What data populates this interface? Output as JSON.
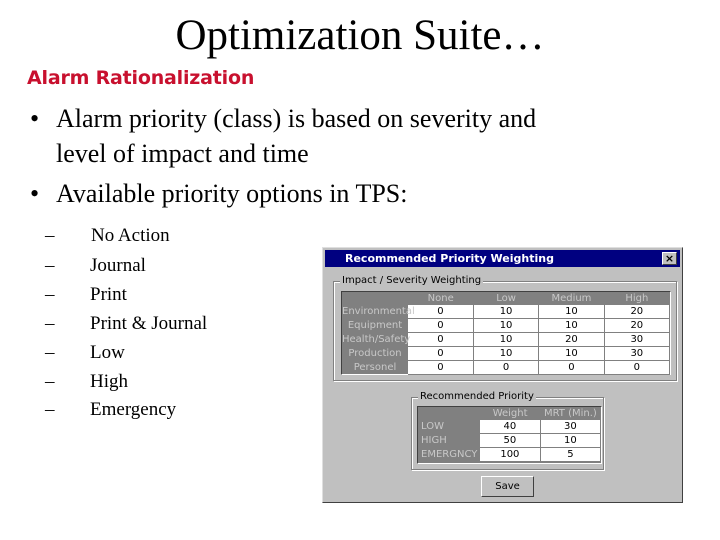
{
  "slide": {
    "title": "Optimization Suite…",
    "subtitle": "Alarm Rationalization",
    "bullets": [
      {
        "symbol": "•",
        "lines": [
          "Alarm priority (class) is based on severity and",
          "level of impact and time"
        ]
      },
      {
        "symbol": "•",
        "lines": [
          "Available priority options in TPS:"
        ]
      }
    ],
    "priority_options": [
      {
        "symbol": "–",
        "label": "No Action"
      },
      {
        "symbol": "–",
        "label": "Journal"
      },
      {
        "symbol": "–",
        "label": "Print"
      },
      {
        "symbol": "–",
        "label": "Print & Journal"
      },
      {
        "symbol": "–",
        "label": "Low"
      },
      {
        "symbol": "–",
        "label": "High"
      },
      {
        "symbol": "–",
        "label": "Emergency"
      }
    ],
    "colors": {
      "subtitle": "#c8102e",
      "titlebar": "#000080",
      "dialog_bg": "#c0c0c0"
    }
  },
  "dialog": {
    "title": "Recommended Priority Weighting",
    "close_icon": "×",
    "impact_group": {
      "label": "Impact / Severity Weighting",
      "columns": [
        "None",
        "Low",
        "Medium",
        "High"
      ],
      "rows": [
        {
          "label": "Environmental",
          "values": [
            "0",
            "10",
            "10",
            "20"
          ]
        },
        {
          "label": "Equipment",
          "values": [
            "0",
            "10",
            "10",
            "20"
          ]
        },
        {
          "label": "Health/Safety",
          "values": [
            "0",
            "10",
            "20",
            "30"
          ]
        },
        {
          "label": "Production",
          "values": [
            "0",
            "10",
            "10",
            "30"
          ]
        },
        {
          "label": "Personel",
          "values": [
            "0",
            "0",
            "0",
            "0"
          ]
        }
      ]
    },
    "priority_group": {
      "label": "Recommended Priority",
      "columns": [
        "Weight",
        "MRT (Min.)"
      ],
      "rows": [
        {
          "label": "LOW",
          "values": [
            "40",
            "30"
          ]
        },
        {
          "label": "HIGH",
          "values": [
            "50",
            "10"
          ]
        },
        {
          "label": "EMERGNCY",
          "values": [
            "100",
            "5"
          ]
        }
      ]
    },
    "save_label": "Save"
  }
}
